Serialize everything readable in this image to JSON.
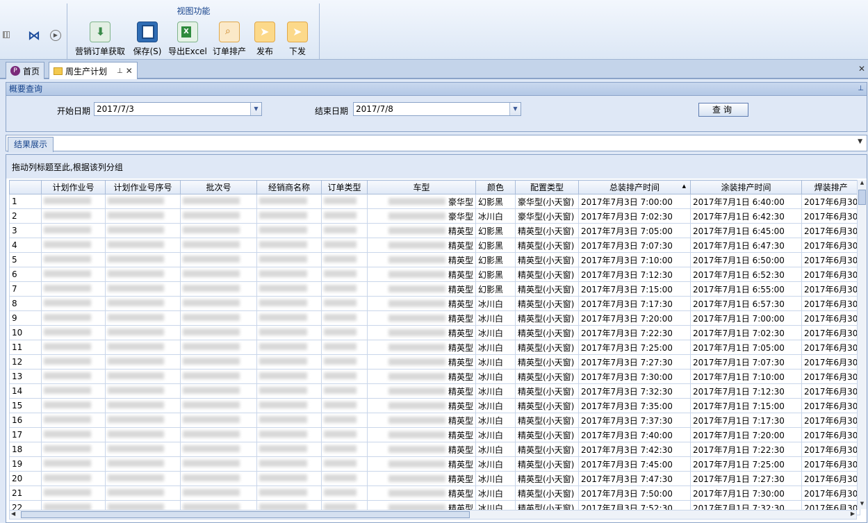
{
  "ribbon": {
    "group_title": "视图功能",
    "buttons": [
      {
        "label": "营销订单获取",
        "icon": "download-icon",
        "color": "#4a9e5a"
      },
      {
        "label": "保存(S)",
        "icon": "save-icon",
        "color": "#2f6db5"
      },
      {
        "label": "导出Excel",
        "icon": "excel-icon",
        "color": "#2e8a3d"
      },
      {
        "label": "订单排产",
        "icon": "search-document-icon",
        "color": "#e8a33a"
      },
      {
        "label": "发布",
        "icon": "send-icon",
        "color": "#f0a93a"
      },
      {
        "label": "下发",
        "icon": "send-icon",
        "color": "#f0a93a"
      }
    ]
  },
  "tabs": [
    {
      "label": "首页",
      "icon": "home-icon"
    },
    {
      "label": "周生产计划",
      "icon": "folder-icon"
    }
  ],
  "summary": {
    "title": "概要查询",
    "start_label": "开始日期",
    "start_value": "2017/7/3",
    "end_label": "结束日期",
    "end_value": "2017/7/8",
    "query_label": "查询"
  },
  "results": {
    "tab_label": "结果展示",
    "group_hint": "拖动列标题至此,根据该列分组",
    "columns": [
      "",
      "计划作业号",
      "计划作业号序号",
      "批次号",
      "经销商名称",
      "订单类型",
      "车型",
      "颜色",
      "配置类型",
      "总装排产时间",
      "涂装排产时间",
      "焊装排产"
    ],
    "rows": [
      [
        "1",
        "豪华型",
        "幻影黑",
        "豪华型(小天窗)",
        "2017年7月3日 7:00:00",
        "2017年7月1日 6:40:00",
        "2017年6月30"
      ],
      [
        "2",
        "豪华型",
        "冰川白",
        "豪华型(小天窗)",
        "2017年7月3日 7:02:30",
        "2017年7月1日 6:42:30",
        "2017年6月30"
      ],
      [
        "3",
        "精英型",
        "幻影黑",
        "精英型(小天窗)",
        "2017年7月3日 7:05:00",
        "2017年7月1日 6:45:00",
        "2017年6月30"
      ],
      [
        "4",
        "精英型",
        "幻影黑",
        "精英型(小天窗)",
        "2017年7月3日 7:07:30",
        "2017年7月1日 6:47:30",
        "2017年6月30"
      ],
      [
        "5",
        "精英型",
        "幻影黑",
        "精英型(小天窗)",
        "2017年7月3日 7:10:00",
        "2017年7月1日 6:50:00",
        "2017年6月30"
      ],
      [
        "6",
        "精英型",
        "幻影黑",
        "精英型(小天窗)",
        "2017年7月3日 7:12:30",
        "2017年7月1日 6:52:30",
        "2017年6月30"
      ],
      [
        "7",
        "精英型",
        "幻影黑",
        "精英型(小天窗)",
        "2017年7月3日 7:15:00",
        "2017年7月1日 6:55:00",
        "2017年6月30"
      ],
      [
        "8",
        "精英型",
        "冰川白",
        "精英型(小天窗)",
        "2017年7月3日 7:17:30",
        "2017年7月1日 6:57:30",
        "2017年6月30"
      ],
      [
        "9",
        "精英型",
        "冰川白",
        "精英型(小天窗)",
        "2017年7月3日 7:20:00",
        "2017年7月1日 7:00:00",
        "2017年6月30"
      ],
      [
        "10",
        "精英型",
        "冰川白",
        "精英型(小天窗)",
        "2017年7月3日 7:22:30",
        "2017年7月1日 7:02:30",
        "2017年6月30"
      ],
      [
        "11",
        "精英型",
        "冰川白",
        "精英型(小天窗)",
        "2017年7月3日 7:25:00",
        "2017年7月1日 7:05:00",
        "2017年6月30"
      ],
      [
        "12",
        "精英型",
        "冰川白",
        "精英型(小天窗)",
        "2017年7月3日 7:27:30",
        "2017年7月1日 7:07:30",
        "2017年6月30"
      ],
      [
        "13",
        "精英型",
        "冰川白",
        "精英型(小天窗)",
        "2017年7月3日 7:30:00",
        "2017年7月1日 7:10:00",
        "2017年6月30"
      ],
      [
        "14",
        "精英型",
        "冰川白",
        "精英型(小天窗)",
        "2017年7月3日 7:32:30",
        "2017年7月1日 7:12:30",
        "2017年6月30"
      ],
      [
        "15",
        "精英型",
        "冰川白",
        "精英型(小天窗)",
        "2017年7月3日 7:35:00",
        "2017年7月1日 7:15:00",
        "2017年6月30"
      ],
      [
        "16",
        "精英型",
        "冰川白",
        "精英型(小天窗)",
        "2017年7月3日 7:37:30",
        "2017年7月1日 7:17:30",
        "2017年6月30"
      ],
      [
        "17",
        "精英型",
        "冰川白",
        "精英型(小天窗)",
        "2017年7月3日 7:40:00",
        "2017年7月1日 7:20:00",
        "2017年6月30"
      ],
      [
        "18",
        "精英型",
        "冰川白",
        "精英型(小天窗)",
        "2017年7月3日 7:42:30",
        "2017年7月1日 7:22:30",
        "2017年6月30"
      ],
      [
        "19",
        "精英型",
        "冰川白",
        "精英型(小天窗)",
        "2017年7月3日 7:45:00",
        "2017年7月1日 7:25:00",
        "2017年6月30"
      ],
      [
        "20",
        "精英型",
        "冰川白",
        "精英型(小天窗)",
        "2017年7月3日 7:47:30",
        "2017年7月1日 7:27:30",
        "2017年6月30"
      ],
      [
        "21",
        "精英型",
        "冰川白",
        "精英型(小天窗)",
        "2017年7月3日 7:50:00",
        "2017年7月1日 7:30:00",
        "2017年6月30"
      ],
      [
        "22",
        "精英型",
        "冰川白",
        "精英型(小天窗)",
        "2017年7月3日 7:52:30",
        "2017年7月1日 7:32:30",
        "2017年6月30"
      ]
    ]
  }
}
